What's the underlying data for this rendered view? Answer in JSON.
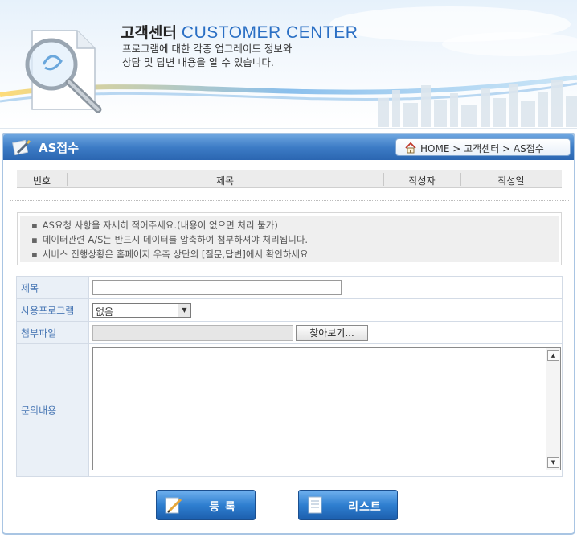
{
  "banner": {
    "title_ko": "고객센터",
    "title_en": "CUSTOMER CENTER",
    "desc_line1": "프로그램에 대한 각종 업그레이드 정보와",
    "desc_line2": "상담 및 답변 내용을 알 수 있습니다."
  },
  "panel": {
    "title": "AS접수",
    "breadcrumb": "HOME > 고객센터 > AS접수"
  },
  "list_headers": [
    "번호",
    "제목",
    "작성자",
    "작성일"
  ],
  "notice": {
    "items": [
      "AS요청 사항을 자세히 적어주세요.(내용이 없으면 처리 불가)",
      "데이터관련 A/S는 반드시 데이터를 압축하여 첨부하셔야 처리됩니다.",
      "서비스 진행상황은 홈페이지 우측 상단의 [질문,답변]에서 확인하세요"
    ]
  },
  "form": {
    "title_label": "제목",
    "title_value": "",
    "program_label": "사용프로그램",
    "program_selected": "없음",
    "attach_label": "첨부파일",
    "attach_value": "",
    "browse_label": "찾아보기...",
    "content_label": "문의내용",
    "content_value": ""
  },
  "buttons": {
    "register": "등 록",
    "list": "리스트"
  },
  "colors": {
    "accent": "#2a6fc4",
    "header_blue": "#3d7cc6",
    "label_text": "#4a78b5"
  }
}
